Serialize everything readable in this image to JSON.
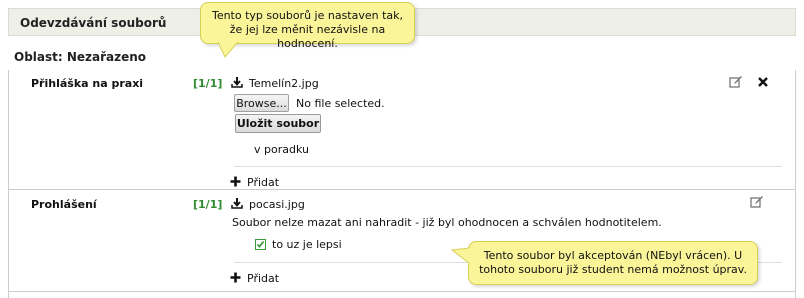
{
  "header": {
    "title": "Odevzdávání souborů"
  },
  "area": {
    "label": "Oblast: Nezařazeno"
  },
  "tooltips": {
    "type_tip": "Tento typ souborů je nastaven tak, že jej lze měnit nezávisle na hodnocení.",
    "accepted_tip": "Tento soubor byl akceptován (NEbyl vrácen). U tohoto souboru již student nemá možnost úprav."
  },
  "items": [
    {
      "label": "Přihláška na praxi",
      "count": "[1/1]",
      "file_name": "Temelín2.jpg",
      "browse_label": "Browse...",
      "no_file_text": "No file selected.",
      "save_label": "Uložit soubor",
      "note": "v poradku",
      "add_label": "Přidat",
      "icons": [
        "download-icon",
        "edit-icon",
        "close-icon",
        "plus-icon"
      ]
    },
    {
      "label": "Prohlášení",
      "count": "[1/1]",
      "file_name": "pocasi.jpg",
      "status_text": "Soubor nelze mazat ani nahradit - již byl ohodnocen a schválen hodnotitelem.",
      "note": "to uz je lepsi",
      "add_label": "Přidat",
      "icons": [
        "download-icon",
        "edit-icon",
        "checkbox-icon",
        "plus-icon"
      ]
    }
  ],
  "colors": {
    "header_bg": "#eef0e8",
    "count_green": "#2e8b2e",
    "tooltip_bg": "#fbf59a",
    "check_green": "#3a9a3a"
  }
}
